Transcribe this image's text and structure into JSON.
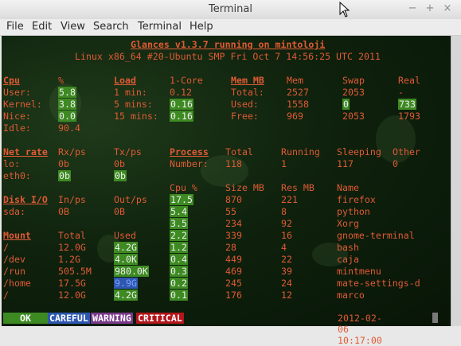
{
  "window": {
    "title": "Terminal"
  },
  "menu": [
    "File",
    "Edit",
    "View",
    "Search",
    "Terminal",
    "Help"
  ],
  "header": {
    "title": "Glances v1.3.7 running on mintoloji",
    "subtitle": "Linux x86_64 #20-Ubuntu SMP Fri Oct 7 14:56:25 UTC 2011"
  },
  "cpu": {
    "label": "Cpu",
    "col": "%",
    "rows": [
      [
        "User:",
        "5.8"
      ],
      [
        "Kernel:",
        "3.8"
      ],
      [
        "Nice:",
        "0.0"
      ],
      [
        "Idle:",
        "90.4"
      ]
    ]
  },
  "load": {
    "label": "Load",
    "col": "1-Core",
    "rows": [
      [
        "1 min:",
        "0.12"
      ],
      [
        "5 mins:",
        "0.16"
      ],
      [
        "15 mins:",
        "0.16"
      ]
    ]
  },
  "mem": {
    "label": "Mem MB",
    "cols": [
      "Mem",
      "Swap",
      "Real"
    ],
    "rows": [
      [
        "Total:",
        "2527",
        "2053",
        "-"
      ],
      [
        "Used:",
        "1558",
        "0",
        "733"
      ],
      [
        "Free:",
        "969",
        "2053",
        "1793"
      ]
    ]
  },
  "net": {
    "label": "Net rate",
    "cols": [
      "Rx/ps",
      "Tx/ps"
    ],
    "rows": [
      [
        "lo:",
        "0b",
        "0b"
      ],
      [
        "eth0:",
        "0b",
        "0b"
      ]
    ]
  },
  "process": {
    "label": "Process",
    "cols": [
      "Total",
      "Running",
      "Sleeping",
      "Other"
    ],
    "row": [
      "Number:",
      "118",
      "1",
      "117",
      "0"
    ]
  },
  "proclist": {
    "cols": [
      "Cpu %",
      "Size MB",
      "Res MB",
      "Name"
    ],
    "rows": [
      [
        "17.5",
        "870",
        "221",
        "firefox"
      ],
      [
        "5.4",
        "55",
        "8",
        "python"
      ],
      [
        "3.5",
        "234",
        "92",
        "Xorg"
      ],
      [
        "2.2",
        "339",
        "16",
        "gnome-terminal"
      ],
      [
        "1.2",
        "28",
        "4",
        "bash"
      ],
      [
        "0.4",
        "449",
        "22",
        "caja"
      ],
      [
        "0.3",
        "469",
        "39",
        "mintmenu"
      ],
      [
        "0.2",
        "245",
        "24",
        "mate-settings-d"
      ],
      [
        "0.1",
        "176",
        "12",
        "marco"
      ]
    ]
  },
  "disk": {
    "label": "Disk I/O",
    "cols": [
      "In/ps",
      "Out/ps"
    ],
    "rows": [
      [
        "sda:",
        "0B",
        "0B"
      ]
    ]
  },
  "mount": {
    "label": "Mount",
    "cols": [
      "Total",
      "Used"
    ],
    "rows": [
      [
        "/",
        "12.0G",
        "4.2G"
      ],
      [
        "/dev",
        "1.2G",
        "4.0K"
      ],
      [
        "/run",
        "505.5M",
        "980.0K"
      ],
      [
        "/home",
        "17.5G",
        "9.9G"
      ],
      [
        "/",
        "12.0G",
        "4.2G"
      ]
    ]
  },
  "status": {
    "ok": "OK",
    "careful": "CAREFUL",
    "warning": "WARNING",
    "critical": "CRITICAL",
    "datetime": "2012-02-06 10:17:00"
  },
  "colors": {
    "accent_green": "#3d8a22",
    "text_orange": "#e05a35",
    "careful": "#2e58b0",
    "warning": "#7a3a8a",
    "critical": "#b4161b"
  }
}
